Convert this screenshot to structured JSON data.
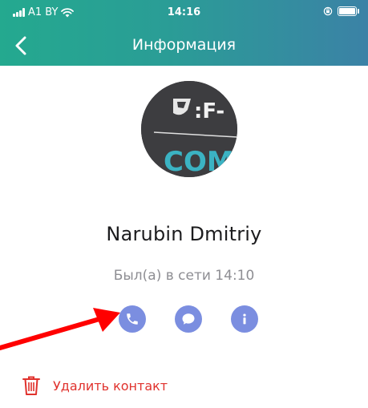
{
  "status_bar": {
    "carrier": "A1 BY",
    "time": "14:16"
  },
  "nav": {
    "title": "Информация"
  },
  "avatar": {
    "logo_text_top": ":F-",
    "logo_text_bottom": "COM"
  },
  "contact": {
    "name": "Narubin Dmitriy",
    "last_seen": "Был(а) в сети 14:10"
  },
  "actions": [
    {
      "icon": "phone-icon"
    },
    {
      "icon": "chat-bubble-icon"
    },
    {
      "icon": "info-icon"
    }
  ],
  "delete_contact": {
    "label": "Удалить контакт"
  },
  "colors": {
    "header_start": "#24a98f",
    "header_end": "#3b82a6",
    "action_buttons": "#7b8ee0",
    "danger": "#e0322d",
    "annotation_arrow": "#ff0000"
  }
}
